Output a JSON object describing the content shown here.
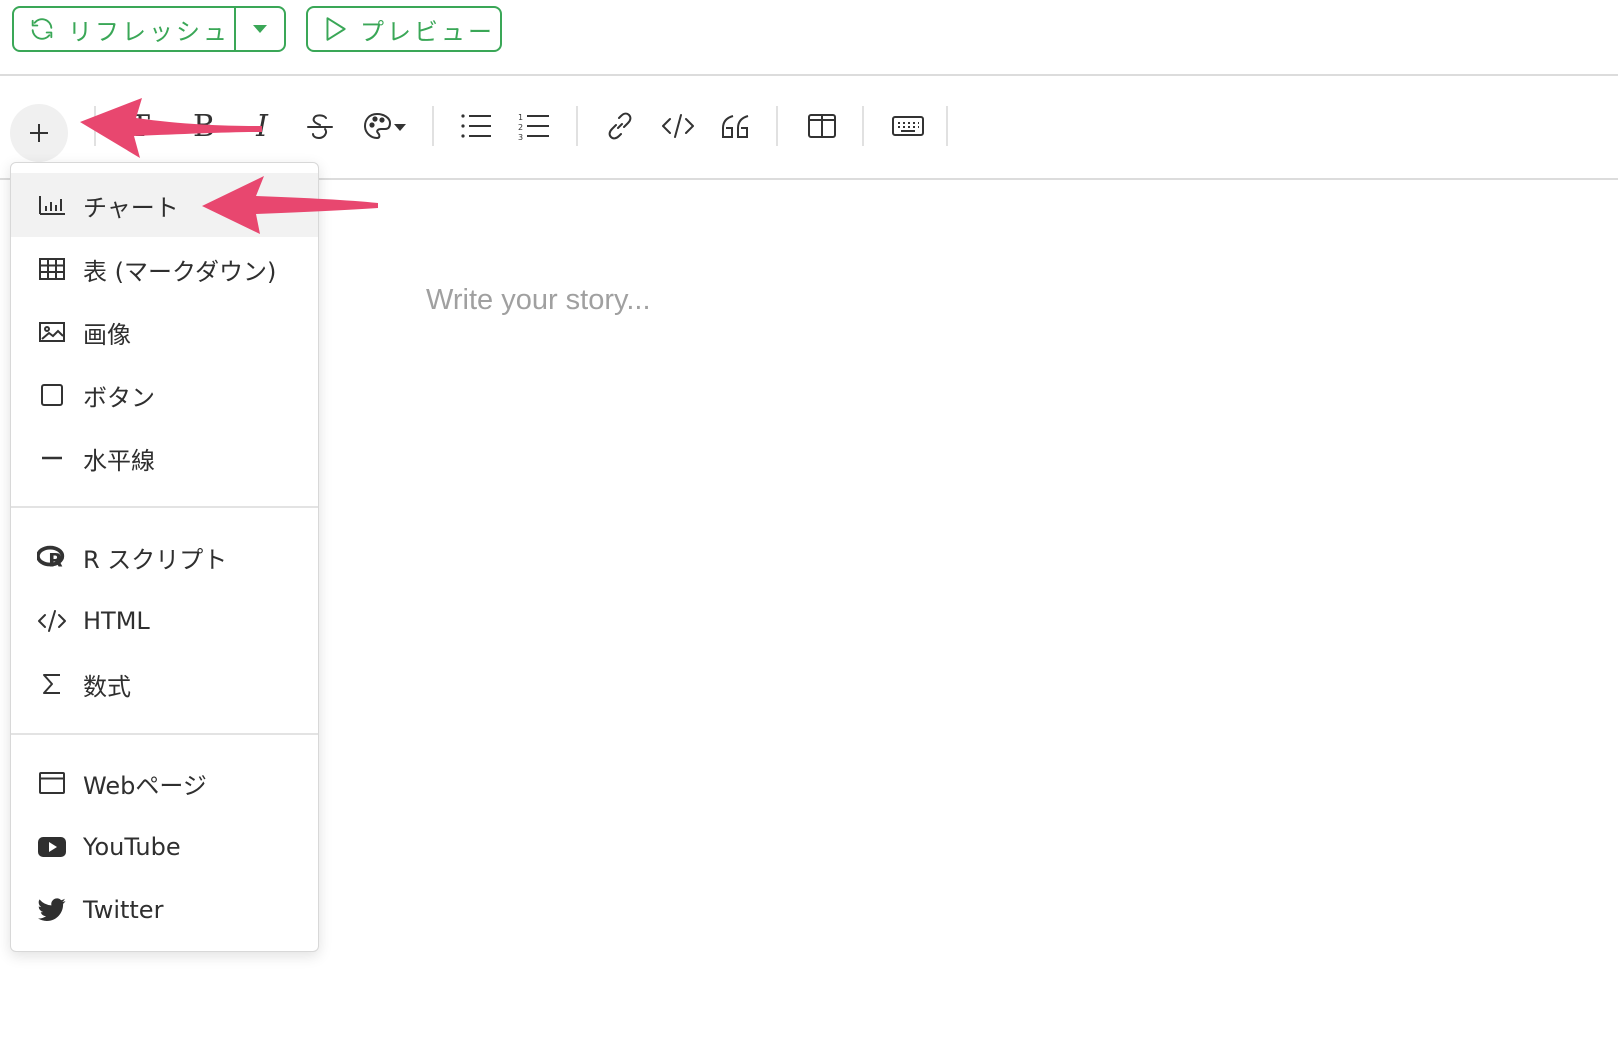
{
  "header": {
    "refresh_label": "リフレッシュ",
    "preview_label": "プレビュー"
  },
  "menu": {
    "sections": [
      {
        "items": [
          {
            "icon": "bar-chart-icon",
            "label": "チャート"
          },
          {
            "icon": "table-icon",
            "label": "表 (マークダウン)"
          },
          {
            "icon": "image-icon",
            "label": "画像"
          },
          {
            "icon": "square-icon",
            "label": "ボタン"
          },
          {
            "icon": "minus-icon",
            "label": "水平線"
          }
        ]
      },
      {
        "items": [
          {
            "icon": "r-logo-icon",
            "label": "R スクリプト"
          },
          {
            "icon": "code-icon",
            "label": "HTML"
          },
          {
            "icon": "sigma-icon",
            "label": "数式"
          }
        ]
      },
      {
        "items": [
          {
            "icon": "browser-window-icon",
            "label": "Webページ"
          },
          {
            "icon": "youtube-icon",
            "label": "YouTube"
          },
          {
            "icon": "twitter-icon",
            "label": "Twitter"
          }
        ]
      }
    ]
  },
  "editor": {
    "placeholder": "Write your story..."
  },
  "colors": {
    "accent": "#3aa757",
    "annotation_arrow": "#e8476f"
  }
}
